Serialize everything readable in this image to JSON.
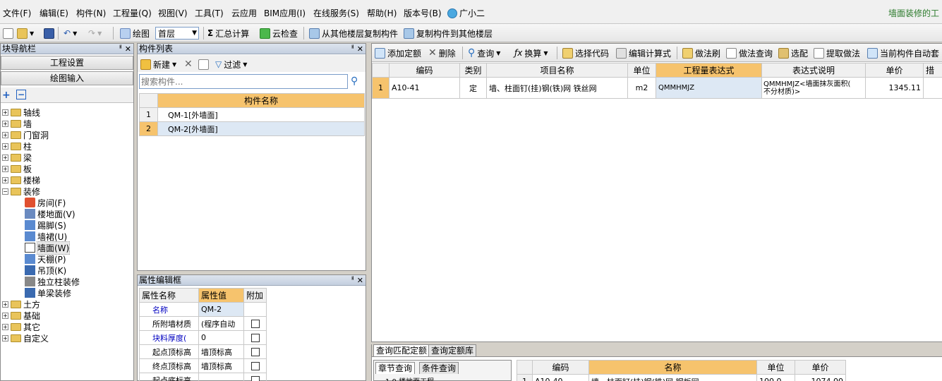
{
  "menu": {
    "items": [
      "文件(F)",
      "编辑(E)",
      "构件(N)",
      "工程量(Q)",
      "视图(V)",
      "工具(T)",
      "云应用",
      "BIM应用(I)",
      "在线服务(S)",
      "帮助(H)",
      "版本号(B)"
    ],
    "assistant": "广小二",
    "status_text": "墙面装修的工"
  },
  "toolbar": {
    "draw_label": "绘图",
    "floor_value": "首层",
    "summary_label": "汇总计算",
    "cloud_check_label": "云检查",
    "copy_from_label": "从其他楼层复制构件",
    "copy_to_label": "复制构件到其他楼层"
  },
  "nav": {
    "title": "块导航栏",
    "project_settings": "工程设置",
    "drawing_input": "绘图输入",
    "tree": [
      "轴线",
      "墙",
      "门窗洞",
      "柱",
      "梁",
      "板",
      "楼梯",
      "装修"
    ],
    "decor_children": [
      "房间(F)",
      "楼地面(V)",
      "踢脚(S)",
      "墙裙(U)",
      "墙面(W)",
      "天棚(P)",
      "吊顶(K)",
      "独立柱装修",
      "单梁装修"
    ],
    "tree_after": [
      "土方",
      "基础",
      "其它",
      "自定义"
    ]
  },
  "components": {
    "title": "构件列表",
    "new_label": "新建",
    "filter_label": "过滤",
    "search_placeholder": "搜索构件...",
    "column": "构件名称",
    "rows": [
      {
        "no": "1",
        "name": "QM-1[外墙面]"
      },
      {
        "no": "2",
        "name": "QM-2[外墙面]"
      }
    ]
  },
  "properties": {
    "title": "属性编辑框",
    "headers": [
      "属性名称",
      "属性值",
      "附加"
    ],
    "rows": [
      {
        "name": "名称",
        "value": "QM-2",
        "blue": true,
        "check": false
      },
      {
        "name": "所附墙材质",
        "value": "(程序自动",
        "blue": false,
        "check": true
      },
      {
        "name": "块料厚度(",
        "value": "0",
        "blue": true,
        "check": true
      },
      {
        "name": "起点顶标高",
        "value": "墙顶标高",
        "blue": false,
        "check": true
      },
      {
        "name": "终点顶标高",
        "value": "墙顶标高",
        "blue": false,
        "check": true
      },
      {
        "name": "起点底标高",
        "value": "",
        "blue": false,
        "check": true
      }
    ]
  },
  "quota_toolbar": {
    "add": "添加定额",
    "delete": "删除",
    "query": "查询",
    "convert": "换算",
    "select_code": "选择代码",
    "edit_formula": "编辑计算式",
    "method_brush": "做法刷",
    "method_query": "做法查询",
    "match": "选配",
    "extract": "提取做法",
    "auto_apply": "当前构件自动套"
  },
  "quota_table": {
    "headers": [
      "编码",
      "类别",
      "项目名称",
      "单位",
      "工程量表达式",
      "表达式说明",
      "单价",
      "措"
    ],
    "rows": [
      {
        "no": "1",
        "code": "A10-41",
        "type": "定",
        "name": "墙、柱面钉(挂)钢(铁)网 铁丝网",
        "unit": "m2",
        "expr": "QMMHMJZ",
        "desc_line1": "QMMHMJZ<墙面抹灰面积(",
        "desc_line2": "不分材质)>",
        "price": "1345.11"
      }
    ]
  },
  "bottom": {
    "tabs": [
      "查询匹配定额",
      "查询定额库"
    ],
    "sub_tabs": [
      "章节查询",
      "条件查询"
    ],
    "headers": [
      "编码",
      "名称",
      "单位",
      "单价"
    ],
    "partial_row": {
      "no": "1",
      "code": "A10-40",
      "name": "墙、柱面钉(挂)钢(铁)网 钢板网",
      "unit": "100.0",
      "price": "1074.00"
    },
    "partial_tree": "1.0 楼地面工程"
  }
}
